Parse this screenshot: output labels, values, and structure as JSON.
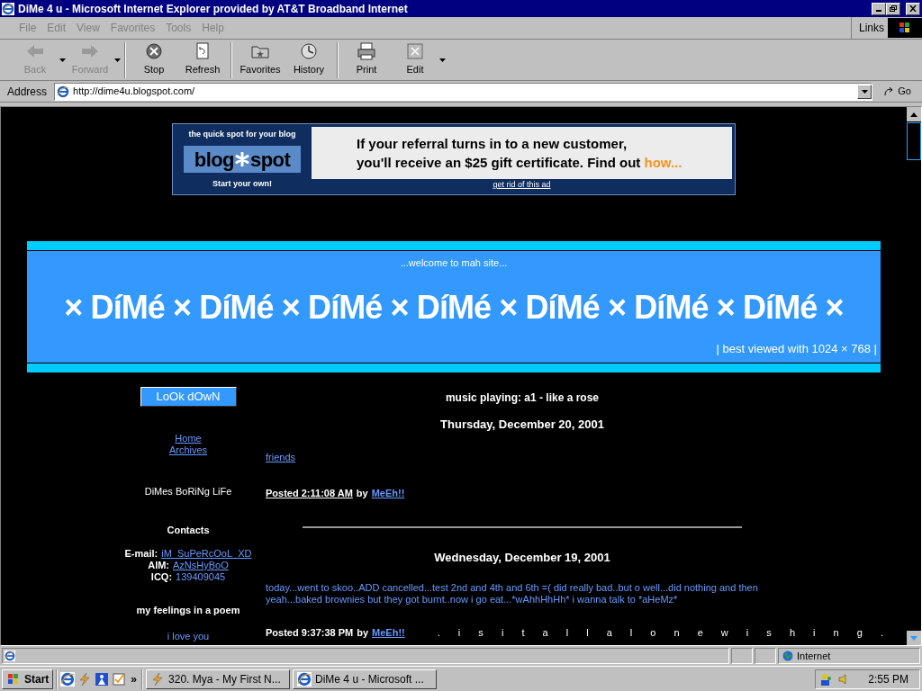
{
  "window": {
    "title": "DiMe 4 u - Microsoft Internet Explorer provided by AT&T Broadband Internet"
  },
  "menu": [
    "File",
    "Edit",
    "View",
    "Favorites",
    "Tools",
    "Help"
  ],
  "links_label": "Links",
  "toolbar": [
    {
      "kind": "back",
      "label": "Back",
      "disabled": true,
      "dropdown": true
    },
    {
      "kind": "forward",
      "label": "Forward",
      "disabled": true,
      "dropdown": true
    },
    {
      "kind": "stop",
      "label": "Stop",
      "disabled": false,
      "dropdown": false
    },
    {
      "kind": "refresh",
      "label": "Refresh",
      "disabled": false,
      "dropdown": false
    },
    {
      "kind": "favorites",
      "label": "Favorites",
      "disabled": false,
      "dropdown": false
    },
    {
      "kind": "history",
      "label": "History",
      "disabled": false,
      "dropdown": false
    },
    {
      "kind": "print",
      "label": "Print",
      "disabled": false,
      "dropdown": false
    },
    {
      "kind": "edit",
      "label": "Edit",
      "disabled": false,
      "dropdown": true
    }
  ],
  "address": {
    "label": "Address",
    "value": "http://dime4u.blogspot.com/",
    "go": "Go"
  },
  "ad": {
    "tagline": "the quick spot for your blog",
    "logo_left": "blog",
    "logo_right": "spot",
    "cta": "Start your own!",
    "line1": "If your referral turns in to a new customer,",
    "line2": "you'll receive an $25 gift certificate.  Find out",
    "how": "how...",
    "dismiss": "get rid of this ad"
  },
  "header": {
    "welcome": "...welcome to mah site...",
    "title": "× DíMé × DíMé × DíMé × DíMé × DíMé × DíMé × DíMé ×",
    "note": "| best viewed with 1024 × 768 |"
  },
  "sidebar": {
    "button": "LoOk dOwN",
    "links": [
      "Home",
      "Archives"
    ],
    "blog_name": "DiMes BoRiNg LiFe",
    "contacts_title": "Contacts",
    "contacts": [
      {
        "label": "E-mail:",
        "value": "iM_SuPeRcOoL_XD",
        "link": true
      },
      {
        "label": "AIM:",
        "value": "AzNsHyBoO",
        "link": true
      },
      {
        "label": "ICQ:",
        "value": "139409045",
        "link": false
      }
    ],
    "poem_title": "my feelings in a poem",
    "poem_line": "i love you"
  },
  "main": {
    "music": "music playing: a1 - like a rose",
    "posts": [
      {
        "date": "Thursday, December 20, 2001",
        "kind": "link",
        "body": "friends",
        "posted": "Posted 2:11:08 AM",
        "posted_link": true,
        "by": "by",
        "author": "MeEh!!"
      },
      {
        "date": "Wednesday, December 19, 2001",
        "kind": "text",
        "body": "today...went to skoo..ADD cancelled...test 2nd and 4th and 6th =( did really bad..but o well...did nothing and then yeah...baked brownies but they got burnt..now i go eat...*wAhhHhHh* i wanna talk to *aHeMz*",
        "posted": "Posted 9:37:38 PM",
        "posted_link": false,
        "by": "by",
        "author": "MeEh!!"
      }
    ],
    "scroller": ". i s i t a l l a l o n e w i s h i n g ."
  },
  "status": {
    "zone": "Internet"
  },
  "taskbar": {
    "start": "Start",
    "more": "»",
    "tasks": [
      "320. Mya - My First N...",
      "DiMe 4 u - Microsoft ..."
    ],
    "clock": "2:55 PM"
  }
}
